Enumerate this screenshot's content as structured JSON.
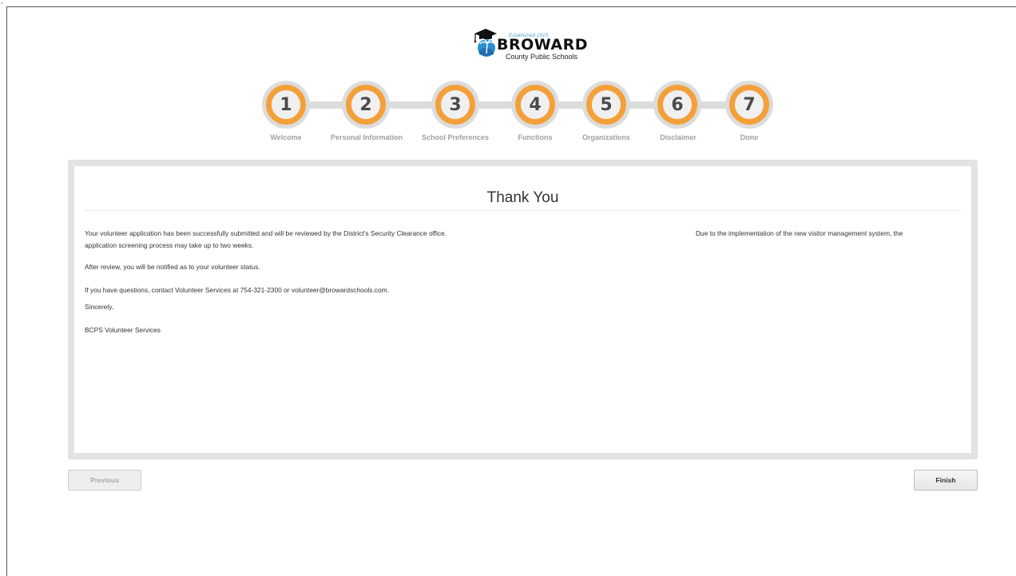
{
  "logo": {
    "established": "Established 1915",
    "name": "BROWARD",
    "subtitle": "County Public Schools"
  },
  "steps": [
    {
      "number": "1",
      "label": "Welcome"
    },
    {
      "number": "2",
      "label": "Personal Information"
    },
    {
      "number": "3",
      "label": "School Preferences"
    },
    {
      "number": "4",
      "label": "Functions"
    },
    {
      "number": "5",
      "label": "Organizations"
    },
    {
      "number": "6",
      "label": "Disclaimer"
    },
    {
      "number": "7",
      "label": "Done"
    }
  ],
  "content": {
    "title": "Thank You",
    "para1_line1": "Your volunteer application has been successfully submitted and will be reviewed by the District's Security Clearance office.",
    "para1_line2": "application screening process may take up to two weeks.",
    "para1_right": "Due to the implementation of the new visitor management system, the",
    "para2": "After review, you will be notified as to your volunteer status.",
    "para3": "If you have questions, contact Volunteer Services at 754-321-2300 or volunteer@browardschools.com.",
    "closing": "Sincerely,",
    "signature": "BCPS Volunteer Services"
  },
  "buttons": {
    "previous": "Previous",
    "finish": "Finish"
  },
  "colors": {
    "step_ring": "#f4a03a",
    "step_track": "#dcdcdc",
    "step_label": "#a0a0a0",
    "logo_accent": "#4a9fd8"
  },
  "icons": {
    "logo_emblem": "graduation-cap-palm-emblem"
  }
}
